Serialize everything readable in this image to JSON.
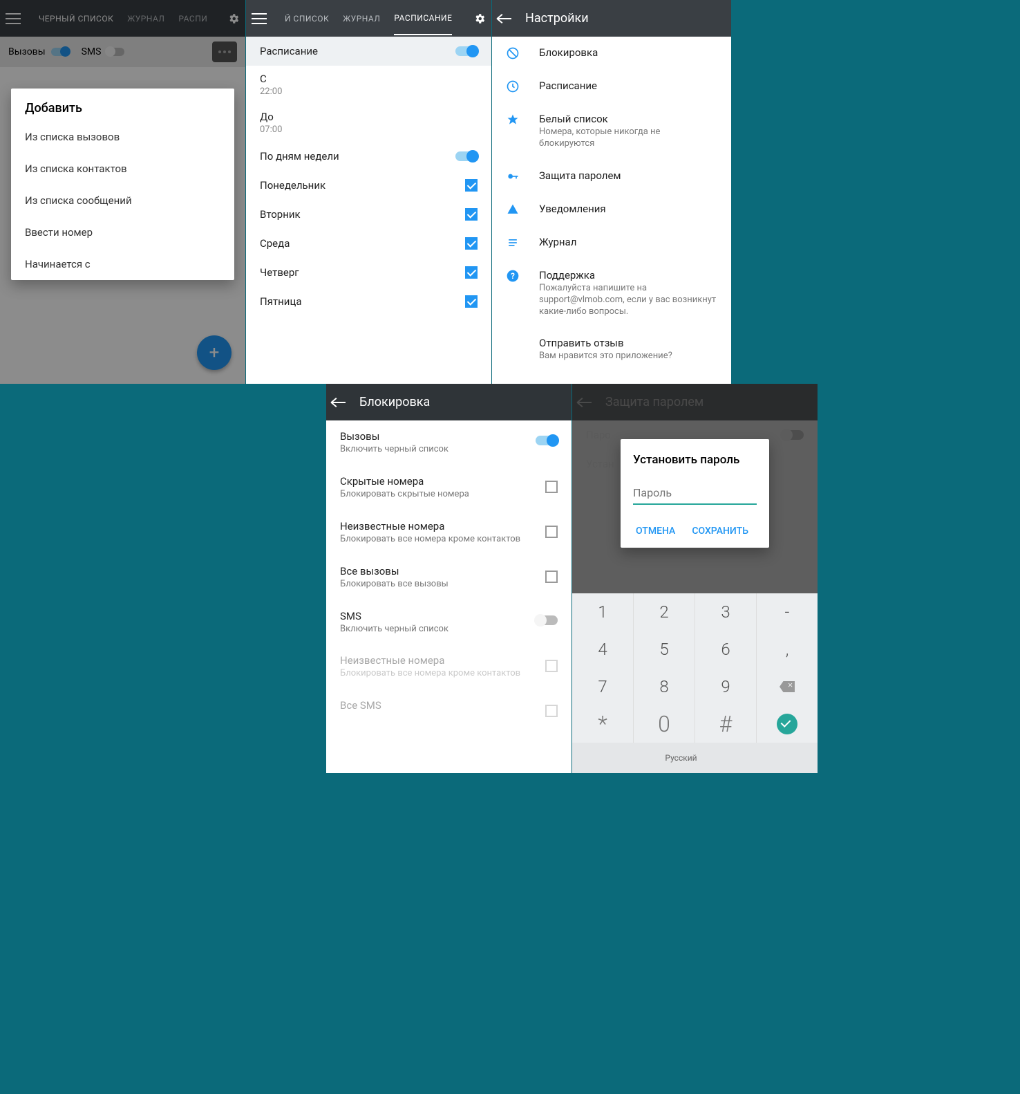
{
  "p1": {
    "tabs": [
      "ЧЕРНЫЙ СПИСОК",
      "ЖУРНАЛ",
      "РАСПИ"
    ],
    "calls": "Вызовы",
    "sms": "SMS",
    "dlg_title": "Добавить",
    "options": [
      "Из списка вызовов",
      "Из списка контактов",
      "Из списка сообщений",
      "Ввести номер",
      "Начинается с"
    ]
  },
  "p2": {
    "tabs": [
      "Й СПИСОК",
      "ЖУРНАЛ",
      "РАСПИСАНИЕ"
    ],
    "sched": "Расписание",
    "from": "С",
    "from_v": "22:00",
    "to": "До",
    "to_v": "07:00",
    "bydays": "По дням недели",
    "days": [
      "Понедельник",
      "Вторник",
      "Среда",
      "Четверг",
      "Пятница"
    ]
  },
  "p3": {
    "title": "Настройки",
    "items": [
      {
        "t": "Блокировка"
      },
      {
        "t": "Расписание"
      },
      {
        "t": "Белый список",
        "s": "Номера, которые никогда не блокируются"
      },
      {
        "t": "Защита паролем"
      },
      {
        "t": "Уведомления"
      },
      {
        "t": "Журнал"
      },
      {
        "t": "Поддержка",
        "s": "Пожалуйста напишите на support@vlmob.com, если у вас возникнут какие-либо вопросы."
      },
      {
        "t": "Отправить отзыв",
        "s": "Вам нравится это приложение?"
      }
    ]
  },
  "p4": {
    "title": "Блокировка",
    "items": [
      {
        "t": "Вызовы",
        "s": "Включить черный список",
        "ctrl": "tg",
        "on": true
      },
      {
        "t": "Скрытые номера",
        "s": "Блокировать скрытые номера",
        "ctrl": "cb"
      },
      {
        "t": "Неизвестные номера",
        "s": "Блокировать все номера кроме контактов",
        "ctrl": "cb"
      },
      {
        "t": "Все вызовы",
        "s": "Блокировать все вызовы",
        "ctrl": "cb"
      },
      {
        "t": "SMS",
        "s": "Включить черный список",
        "ctrl": "tg",
        "on": false
      },
      {
        "t": "Неизвестные номера",
        "s": "Блокировать все номера кроме контактов",
        "ctrl": "cb",
        "dis": true
      },
      {
        "t": "Все SMS",
        "s": "",
        "ctrl": "cb",
        "dis": true
      }
    ]
  },
  "p5": {
    "title": "Защита паролем",
    "pwd": "Паро",
    "set": "Устан",
    "dlg_title": "Установить пароль",
    "placeholder": "Пароль",
    "cancel": "ОТМЕНА",
    "save": "СОХРАНИТЬ",
    "lang": "Русский",
    "keys": [
      [
        "1",
        "2",
        "3",
        "-"
      ],
      [
        "4",
        "5",
        "6",
        ","
      ],
      [
        "7",
        "8",
        "9",
        "bsp"
      ],
      [
        "*",
        "0",
        "#",
        "done"
      ]
    ]
  }
}
